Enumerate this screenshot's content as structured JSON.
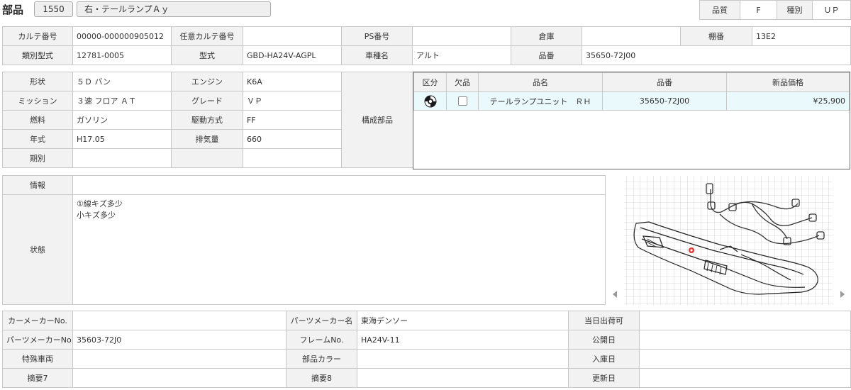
{
  "header": {
    "title": "部品",
    "code": "1550",
    "name": "右・テールランプＡｙ",
    "quality_label": "品質",
    "quality_value": "F",
    "type_label": "種別",
    "type_value": "ＵＰ"
  },
  "top": {
    "karte_no_label": "カルテ番号",
    "karte_no": "00000-000000905012",
    "opt_karte_label": "任意カルテ番号",
    "opt_karte": "",
    "ps_no_label": "PS番号",
    "ps_no": "",
    "warehouse_label": "倉庫",
    "warehouse": "",
    "shelf_label": "棚番",
    "shelf": "13E2",
    "class_model_label": "類別型式",
    "class_model": "12781-0005",
    "model_label": "型式",
    "model": "GBD-HA24V-AGPL",
    "car_name_label": "車種名",
    "car_name": "アルト",
    "part_no_label": "品番",
    "part_no": "35650-72J00"
  },
  "spec": {
    "shape_label": "形状",
    "shape": "５Ｄ バン",
    "engine_label": "エンジン",
    "engine": "K6A",
    "mission_label": "ミッション",
    "mission": "３速 フロア ＡＴ",
    "grade_label": "グレード",
    "grade": "ＶＰ",
    "fuel_label": "燃料",
    "fuel": "ガソリン",
    "drive_label": "駆動方式",
    "drive": "FF",
    "year_label": "年式",
    "year": "H17.05",
    "displacement_label": "排気量",
    "displacement": "660",
    "period_label": "期別",
    "period": "",
    "components_label": "構成部品"
  },
  "parts": {
    "headers": [
      "区分",
      "欠品",
      "品名",
      "品番",
      "新品価格"
    ],
    "rows": [
      {
        "name": "テールランプユニット　ＲＨ",
        "part_no": "35650-72J00",
        "price": "¥25,900"
      }
    ]
  },
  "info": {
    "info_label": "情報",
    "info": "",
    "condition_label": "状態",
    "condition": "①線キズ多少\n小キズ多少"
  },
  "image": {
    "prev_icon": "triangle-left",
    "next_icon": "triangle-right"
  },
  "bottom": {
    "car_maker_no_label": "カーメーカーNo.",
    "car_maker_no": "",
    "parts_maker_name_label": "パーツメーカー名",
    "parts_maker_name": "東海デンソー",
    "same_day_label": "当日出荷可",
    "same_day": "",
    "parts_maker_no_label": "パーツメーカーNo.",
    "parts_maker_no": "35603-72J0",
    "frame_no_label": "フレームNo.",
    "frame_no": "HA24V-11",
    "publish_label": "公開日",
    "publish": "",
    "special_label": "特殊車両",
    "special": "",
    "color_label": "部品カラー",
    "color": "",
    "stock_in_label": "入庫日",
    "stock_in": "",
    "memo7_label": "摘要7",
    "memo7": "",
    "memo8_label": "摘要8",
    "memo8": "",
    "updated_label": "更新日",
    "updated": ""
  }
}
